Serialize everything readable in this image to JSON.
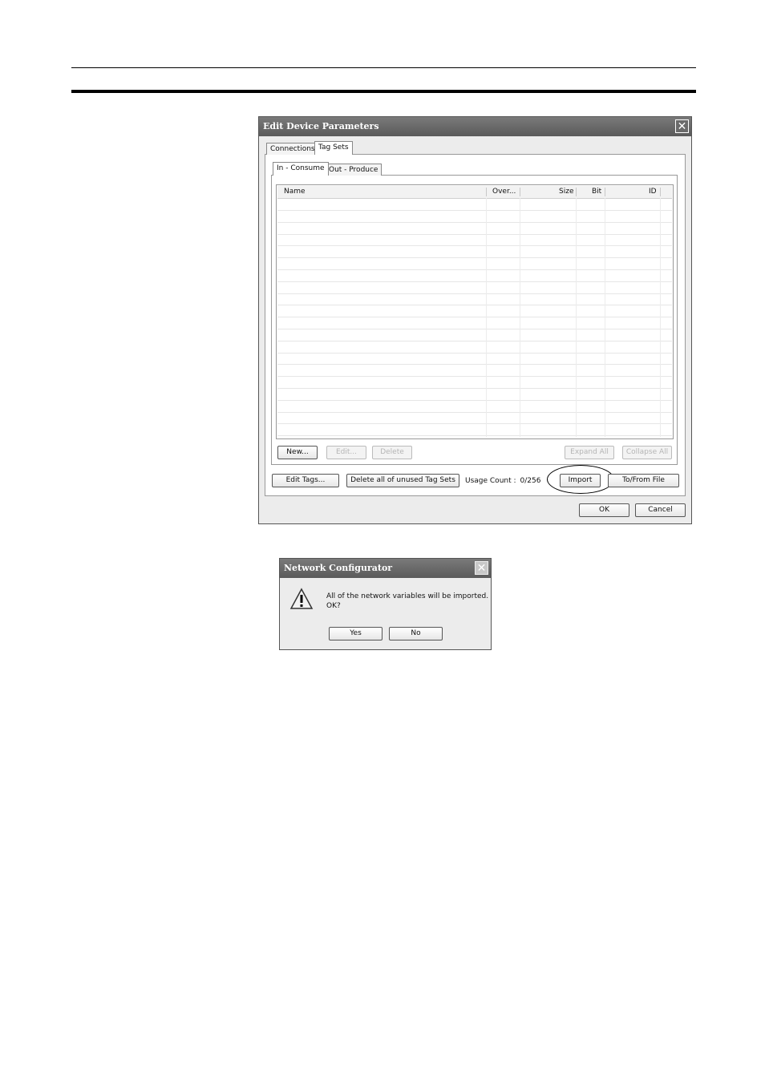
{
  "main_dialog": {
    "title": "Edit Device Parameters",
    "close_glyph": "✕",
    "tabs": [
      "Connections",
      "Tag Sets"
    ],
    "subtabs": [
      "In - Consume",
      "Out - Produce"
    ],
    "columns": [
      "Name",
      "Over...",
      "Size",
      "Bit",
      "ID"
    ],
    "rows": [],
    "buttons": {
      "new": "New...",
      "edit": "Edit...",
      "delete": "Delete",
      "expand_all": "Expand All",
      "collapse_all": "Collapse All",
      "edit_tags": "Edit Tags...",
      "delete_unused": "Delete all of unused Tag Sets",
      "import": "Import",
      "to_from_file": "To/From File",
      "ok": "OK",
      "cancel": "Cancel"
    },
    "usage_label": "Usage Count :",
    "usage_value": "0/256"
  },
  "message_box": {
    "title": "Network Configurator",
    "close_glyph": "✕",
    "icon": "warning-icon",
    "line1": "All of the network variables will be imported.",
    "line2": "OK?",
    "yes": "Yes",
    "no": "No"
  }
}
